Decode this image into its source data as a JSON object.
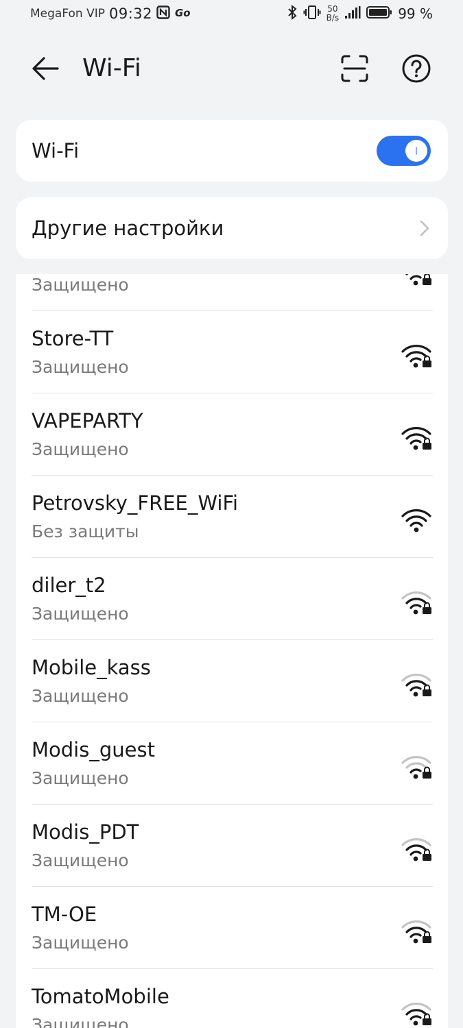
{
  "status_bar": {
    "carrier": "MegaFon VIP",
    "time": "09:32",
    "net_speed_value": "50",
    "net_speed_unit": "B/s",
    "battery": "99 %",
    "icons": [
      "nfc-icon",
      "go-icon",
      "bluetooth-icon",
      "vibrate-icon",
      "signal-icon",
      "battery-icon"
    ]
  },
  "app_bar": {
    "title": "Wi-Fi",
    "icons": [
      "back-arrow-icon",
      "scan-icon",
      "help-icon"
    ]
  },
  "wifi_toggle": {
    "label": "Wi-Fi",
    "on": true,
    "accent_color": "#2A72F0"
  },
  "other_settings": {
    "label": "Другие настройки"
  },
  "networks": [
    {
      "name": "",
      "status": "Защищено",
      "secured": true,
      "signal": 3
    },
    {
      "name": "Store-TT",
      "status": "Защищено",
      "secured": true,
      "signal": 3
    },
    {
      "name": "VAPEPARTY",
      "status": "Защищено",
      "secured": true,
      "signal": 3
    },
    {
      "name": "Petrovsky_FREE_WiFi",
      "status": "Без защиты",
      "secured": false,
      "signal": 3
    },
    {
      "name": "diler_t2",
      "status": "Защищено",
      "secured": true,
      "signal": 1
    },
    {
      "name": "Mobile_kass",
      "status": "Защищено",
      "secured": true,
      "signal": 1
    },
    {
      "name": "Modis_guest",
      "status": "Защищено",
      "secured": true,
      "signal": 1
    },
    {
      "name": "Modis_PDT",
      "status": "Защищено",
      "secured": true,
      "signal": 1
    },
    {
      "name": "TM-OE",
      "status": "Защищено",
      "secured": true,
      "signal": 1
    },
    {
      "name": "TomatoMobile",
      "status": "Защищено",
      "secured": true,
      "signal": 1
    }
  ]
}
